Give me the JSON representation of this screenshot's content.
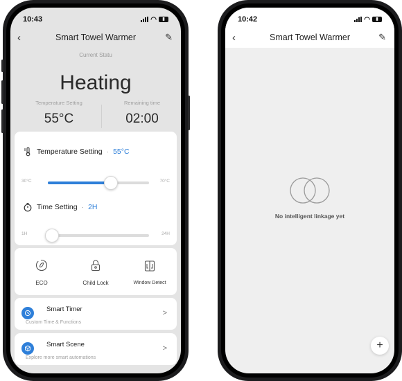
{
  "left": {
    "status": {
      "time": "10:43"
    },
    "nav": {
      "title": "Smart Towel Warmer"
    },
    "current_status_label": "Current Statu",
    "mode_text": "Heating",
    "temperature": {
      "label": "Temperature Setting",
      "value": "55°C"
    },
    "remaining": {
      "label": "Remaining time",
      "value": "02:00"
    },
    "temp_setting": {
      "label": "Temperature Setting",
      "separator": "·",
      "value": "55°C",
      "min": "30°C",
      "max": "70°C",
      "level_fraction": 0.62
    },
    "time_setting": {
      "label": "Time Setting",
      "separator": "·",
      "value": "2H",
      "min": "1H",
      "max": "24H",
      "level_fraction": 0.04
    },
    "modes": [
      {
        "label": "ECO",
        "icon": "eco-icon"
      },
      {
        "label": "Child Lock",
        "icon": "lock-icon"
      },
      {
        "label": "Window Detect",
        "icon": "window-icon"
      }
    ],
    "smart_timer": {
      "title": "Smart Timer",
      "subtitle": "Custom Time & Functions",
      "chevron": ">"
    },
    "smart_scene": {
      "title": "Smart Scene",
      "subtitle": "Explore more smart automations",
      "chevron": ">"
    }
  },
  "right": {
    "status": {
      "time": "10:42"
    },
    "nav": {
      "title": "Smart Towel Warmer"
    },
    "empty_message": "No intelligent linkage yet",
    "fab_label": "+"
  },
  "colors": {
    "accent": "#2e7fd9",
    "background_gray": "#e4e4e4",
    "card": "#ffffff"
  }
}
